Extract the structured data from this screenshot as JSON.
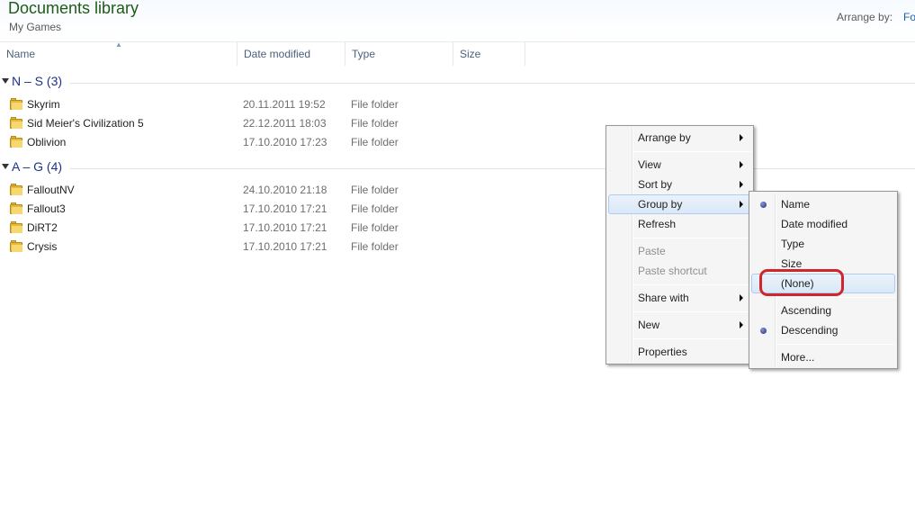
{
  "header": {
    "title": "Documents library",
    "subtitle": "My Games",
    "arrange_by_label": "Arrange by:",
    "arrange_by_value": "Fo"
  },
  "columns": [
    "Name",
    "Date modified",
    "Type",
    "Size"
  ],
  "groups": [
    {
      "label": "N – S (3)",
      "items": [
        {
          "name": "Skyrim",
          "date": "20.11.2011 19:52",
          "type": "File folder"
        },
        {
          "name": "Sid Meier's Civilization 5",
          "date": "22.12.2011 18:03",
          "type": "File folder"
        },
        {
          "name": "Oblivion",
          "date": "17.10.2010 17:23",
          "type": "File folder"
        }
      ]
    },
    {
      "label": "A – G (4)",
      "items": [
        {
          "name": "FalloutNV",
          "date": "24.10.2010 21:18",
          "type": "File folder"
        },
        {
          "name": "Fallout3",
          "date": "17.10.2010 17:21",
          "type": "File folder"
        },
        {
          "name": "DiRT2",
          "date": "17.10.2010 17:21",
          "type": "File folder"
        },
        {
          "name": "Crysis",
          "date": "17.10.2010 17:21",
          "type": "File folder"
        }
      ]
    }
  ],
  "context_menu": {
    "arrange_by": "Arrange by",
    "view": "View",
    "sort_by": "Sort by",
    "group_by": "Group by",
    "refresh": "Refresh",
    "paste": "Paste",
    "paste_shortcut": "Paste shortcut",
    "share_with": "Share with",
    "new": "New",
    "properties": "Properties"
  },
  "group_by_submenu": {
    "name": "Name",
    "date_modified": "Date modified",
    "type": "Type",
    "size": "Size",
    "none": "(None)",
    "ascending": "Ascending",
    "descending": "Descending",
    "more": "More...",
    "selected_field": "Name",
    "selected_order": "Descending"
  },
  "colors": {
    "title": "#1e5b16",
    "group_label": "#1e3287",
    "highlight": "#dbe8f7",
    "annotation": "#d0252a"
  }
}
